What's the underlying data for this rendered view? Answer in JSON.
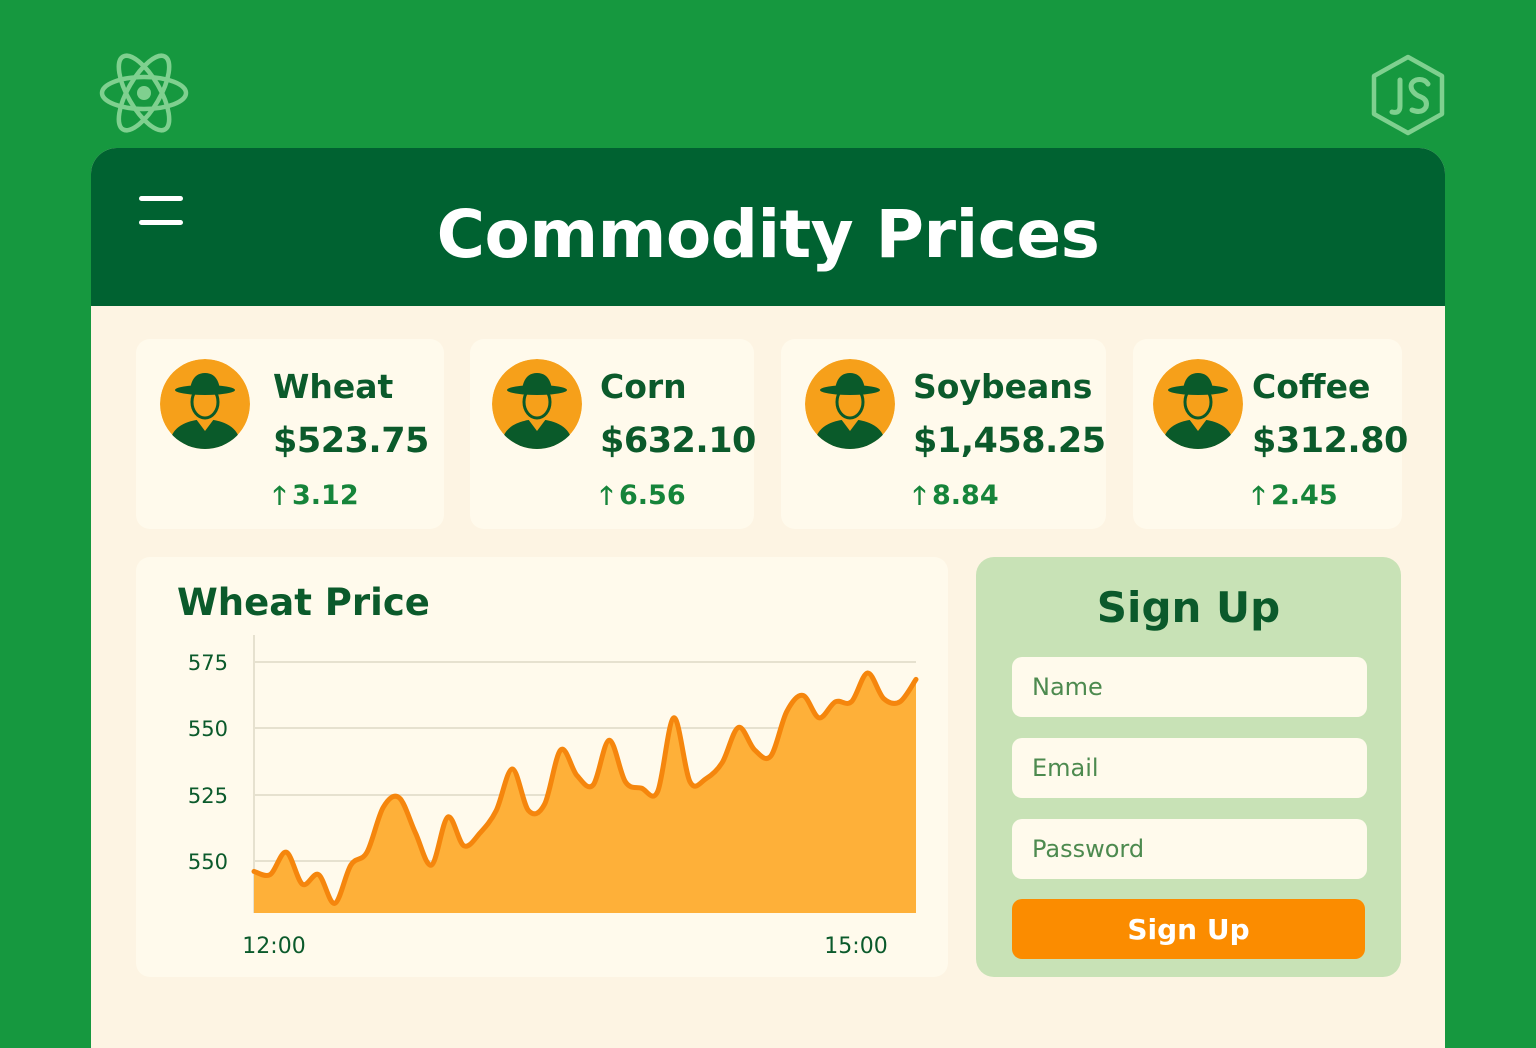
{
  "header": {
    "title": "Commodity Prices"
  },
  "logos": {
    "left_icon": "react-atom-icon",
    "right_icon": "nodejs-hexagon-icon"
  },
  "commodities": [
    {
      "name": "Wheat",
      "price": "$523.75",
      "change": "3.12",
      "direction": "up"
    },
    {
      "name": "Corn",
      "price": "$632.10",
      "change": "6.56",
      "direction": "up"
    },
    {
      "name": "Soybeans",
      "price": "$1,458.25",
      "change": "8.84",
      "direction": "up"
    },
    {
      "name": "Coffee",
      "price": "$312.80",
      "change": "2.45",
      "direction": "up"
    }
  ],
  "chart": {
    "title": "Wheat Price"
  },
  "chart_data": {
    "type": "area",
    "title": "Wheat Price",
    "y_tick_labels": [
      "575",
      "550",
      "525",
      "550"
    ],
    "x_tick_labels": [
      "12:00",
      "15:00"
    ],
    "grid": "horizontal",
    "x": [
      0,
      1,
      2,
      3,
      4,
      5,
      6,
      7,
      8,
      9,
      10,
      11,
      12,
      13,
      14,
      15,
      16,
      17,
      18,
      19,
      20,
      21,
      22,
      23,
      24,
      25,
      26,
      27,
      28,
      29,
      30,
      31,
      32,
      33,
      34,
      35,
      36,
      37,
      38,
      39,
      40,
      41
    ],
    "values": [
      513,
      512,
      519,
      509,
      512,
      503,
      515,
      519,
      533,
      536,
      525,
      515,
      530,
      521,
      525,
      532,
      545,
      532,
      534,
      551,
      543,
      540,
      554,
      541,
      539,
      538,
      561,
      541,
      542,
      547,
      558,
      551,
      549,
      563,
      568,
      561,
      566,
      566,
      575,
      567,
      566,
      573
    ],
    "ylim": [
      500,
      580
    ]
  },
  "signup": {
    "title": "Sign Up",
    "name_placeholder": "Name",
    "email_placeholder": "Email",
    "password_placeholder": "Password",
    "button_label": "Sign Up"
  },
  "colors": {
    "background": "#16983f",
    "header": "#006231",
    "panel": "#fffaec",
    "text_dark_green": "#0b5a2b",
    "change_green": "#16843a",
    "accent_orange": "#fb8c00",
    "area_fill": "#feb039",
    "signup_panel": "#c8e2b6"
  }
}
